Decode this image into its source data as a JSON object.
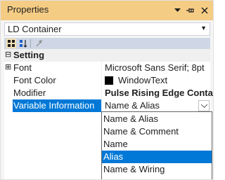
{
  "window": {
    "title": "Properties"
  },
  "selector": {
    "value": "LD Container"
  },
  "category": {
    "label": "Setting",
    "expander": "⊟"
  },
  "properties": [
    {
      "name": "Font",
      "value": "Microsoft Sans Serif; 8pt",
      "expander": "⊞"
    },
    {
      "name": "Font Color",
      "value": "WindowText",
      "swatch": "#000000"
    },
    {
      "name": "Modifier",
      "value": "Pulse Rising Edge Contact"
    },
    {
      "name": "Variable Information",
      "value": "Name & Alias"
    }
  ],
  "dropdown": {
    "options": [
      "Name & Alias",
      "Name & Comment",
      "Name",
      "Alias",
      "Name & Wiring"
    ],
    "highlighted": "Alias"
  },
  "colors": {
    "titlebar": "#f5cc84",
    "selection": "#0078d7",
    "toolbar": "#cfd6e5"
  },
  "icons": [
    "categorized-icon",
    "alphabetical-icon",
    "property-pages-icon",
    "dropdown-arrow-icon",
    "pin-icon",
    "close-icon"
  ]
}
